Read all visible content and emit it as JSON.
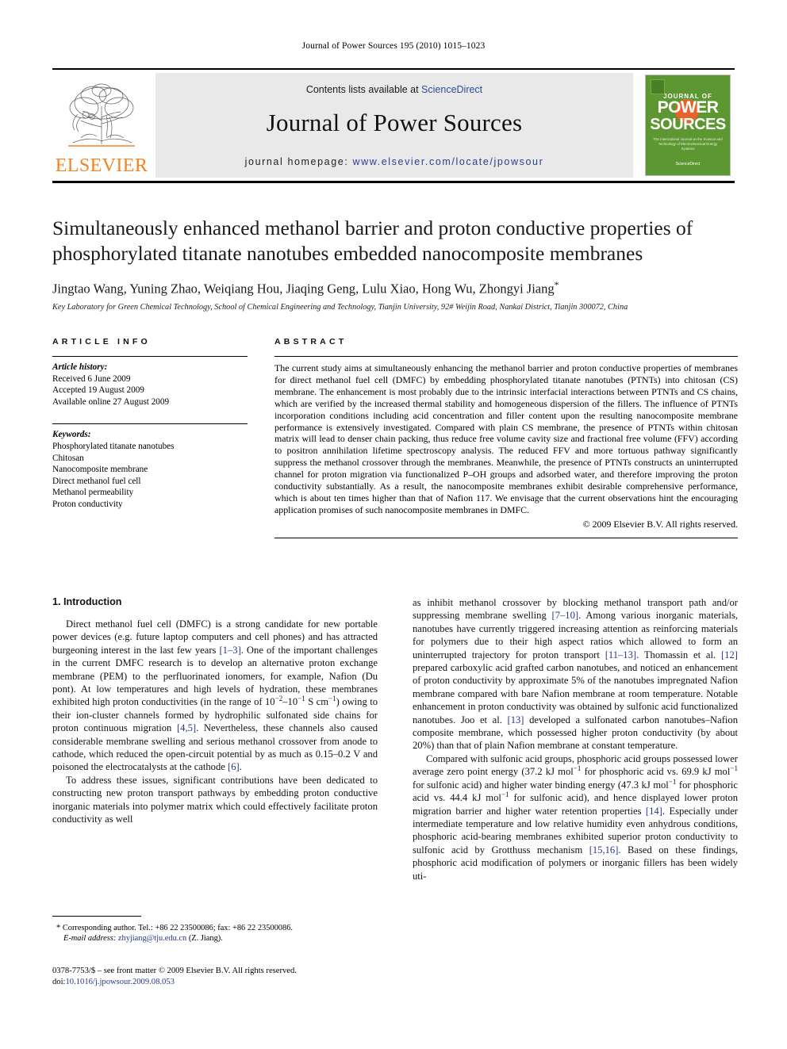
{
  "running_head": "Journal of Power Sources 195 (2010) 1015–1023",
  "masthead": {
    "publisher_name": "ELSEVIER",
    "contents_prefix": "Contents lists available at ",
    "contents_link": "ScienceDirect",
    "journal_name": "Journal of Power Sources",
    "homepage_label": "journal homepage: ",
    "homepage_url": "www.elsevier.com/locate/jpowsour",
    "cover": {
      "kicker": "JOURNAL OF",
      "word1": "POWER",
      "word2": "SOURCES",
      "subtitle": "The International Journal on the Science and Technology of Electrochemical Energy Systems",
      "sciencedirect": "ScienceDirect"
    }
  },
  "article": {
    "title": "Simultaneously enhanced methanol barrier and proton conductive properties of phosphorylated titanate nanotubes embedded nanocomposite membranes",
    "authors": "Jingtao Wang, Yuning Zhao, Weiqiang Hou, Jiaqing Geng, Lulu Xiao, Hong Wu, Zhongyi Jiang",
    "corresponding_marker": "*",
    "affiliation": "Key Laboratory for Green Chemical Technology, School of Chemical Engineering and Technology, Tianjin University, 92# Weijin Road, Nankai District, Tianjin 300072, China"
  },
  "article_info": {
    "heading": "ARTICLE INFO",
    "history_label": "Article history:",
    "history": [
      "Received 6 June 2009",
      "Accepted 19 August 2009",
      "Available online 27 August 2009"
    ],
    "keywords_label": "Keywords:",
    "keywords": [
      "Phosphorylated titanate nanotubes",
      "Chitosan",
      "Nanocomposite membrane",
      "Direct methanol fuel cell",
      "Methanol permeability",
      "Proton conductivity"
    ]
  },
  "abstract": {
    "heading": "ABSTRACT",
    "text": "The current study aims at simultaneously enhancing the methanol barrier and proton conductive properties of membranes for direct methanol fuel cell (DMFC) by embedding phosphorylated titanate nanotubes (PTNTs) into chitosan (CS) membrane. The enhancement is most probably due to the intrinsic interfacial interactions between PTNTs and CS chains, which are verified by the increased thermal stability and homogeneous dispersion of the fillers. The influence of PTNTs incorporation conditions including acid concentration and filler content upon the resulting nanocomposite membrane performance is extensively investigated. Compared with plain CS membrane, the presence of PTNTs within chitosan matrix will lead to denser chain packing, thus reduce free volume cavity size and fractional free volume (FFV) according to positron annihilation lifetime spectroscopy analysis. The reduced FFV and more tortuous pathway significantly suppress the methanol crossover through the membranes. Meanwhile, the presence of PTNTs constructs an uninterrupted channel for proton migration via functionalized P–OH groups and adsorbed water, and therefore improving the proton conductivity substantially. As a result, the nanocomposite membranes exhibit desirable comprehensive performance, which is about ten times higher than that of Nafion 117. We envisage that the current observations hint the encouraging application promises of such nanocomposite membranes in DMFC.",
    "copyright": "© 2009 Elsevier B.V. All rights reserved."
  },
  "introduction": {
    "heading": "1. Introduction",
    "left_paragraphs": [
      "Direct methanol fuel cell (DMFC) is a strong candidate for new portable power devices (e.g. future laptop computers and cell phones) and has attracted burgeoning interest in the last few years [1–3]. One of the important challenges in the current DMFC research is to develop an alternative proton exchange membrane (PEM) to the perfluorinated ionomers, for example, Nafion (Du pont). At low temperatures and high levels of hydration, these membranes exhibited high proton conductivities (in the range of 10−2–10−1 S cm−1) owing to their ion-cluster channels formed by hydrophilic sulfonated side chains for proton continuous migration [4,5]. Nevertheless, these channels also caused considerable membrane swelling and serious methanol crossover from anode to cathode, which reduced the open-circuit potential by as much as 0.15–0.2 V and poisoned the electrocatalysts at the cathode [6].",
      "To address these issues, significant contributions have been dedicated to constructing new proton transport pathways by embedding proton conductive inorganic materials into polymer matrix which could effectively facilitate proton conductivity as well"
    ],
    "right_paragraphs": [
      "as inhibit methanol crossover by blocking methanol transport path and/or suppressing membrane swelling [7–10]. Among various inorganic materials, nanotubes have currently triggered increasing attention as reinforcing materials for polymers due to their high aspect ratios which allowed to form an uninterrupted trajectory for proton transport [11–13]. Thomassin et al. [12] prepared carboxylic acid grafted carbon nanotubes, and noticed an enhancement of proton conductivity by approximate 5% of the nanotubes impregnated Nafion membrane compared with bare Nafion membrane at room temperature. Notable enhancement in proton conductivity was obtained by sulfonic acid functionalized nanotubes. Joo et al. [13] developed a sulfonated carbon nanotubes–Nafion composite membrane, which possessed higher proton conductivity (by about 20%) than that of plain Nafion membrane at constant temperature.",
      "Compared with sulfonic acid groups, phosphoric acid groups possessed lower average zero point energy (37.2 kJ mol−1 for phosphoric acid vs. 69.9 kJ mol−1 for sulfonic acid) and higher water binding energy (47.3 kJ mol−1 for phosphoric acid vs. 44.4 kJ mol−1 for sulfonic acid), and hence displayed lower proton migration barrier and higher water retention properties [14]. Especially under intermediate temperature and low relative humidity even anhydrous conditions, phosphoric acid-bearing membranes exhibited superior proton conductivity to sulfonic acid by Grotthuss mechanism [15,16]. Based on these findings, phosphoric acid modification of polymers or inorganic fillers has been widely uti-"
    ]
  },
  "footnote": {
    "marker": "*",
    "corresponding": "Corresponding author. Tel.: +86 22 23500086; fax: +86 22 23500086.",
    "email_label": "E-mail address:",
    "email": "zhyjiang@tju.edu.cn",
    "email_suffix": "(Z. Jiang)."
  },
  "imprint": {
    "line1": "0378-7753/$ – see front matter © 2009 Elsevier B.V. All rights reserved.",
    "doi_label": "doi:",
    "doi": "10.1016/j.jpowsour.2009.08.053"
  },
  "colors": {
    "link_blue": "#26348b",
    "sciencedirect_blue": "#2c4b9b",
    "elsevier_orange": "#F58220",
    "cover_green": "#5d9732",
    "cover_orange": "#e8622a",
    "band_gray": "#e9e9e9"
  }
}
